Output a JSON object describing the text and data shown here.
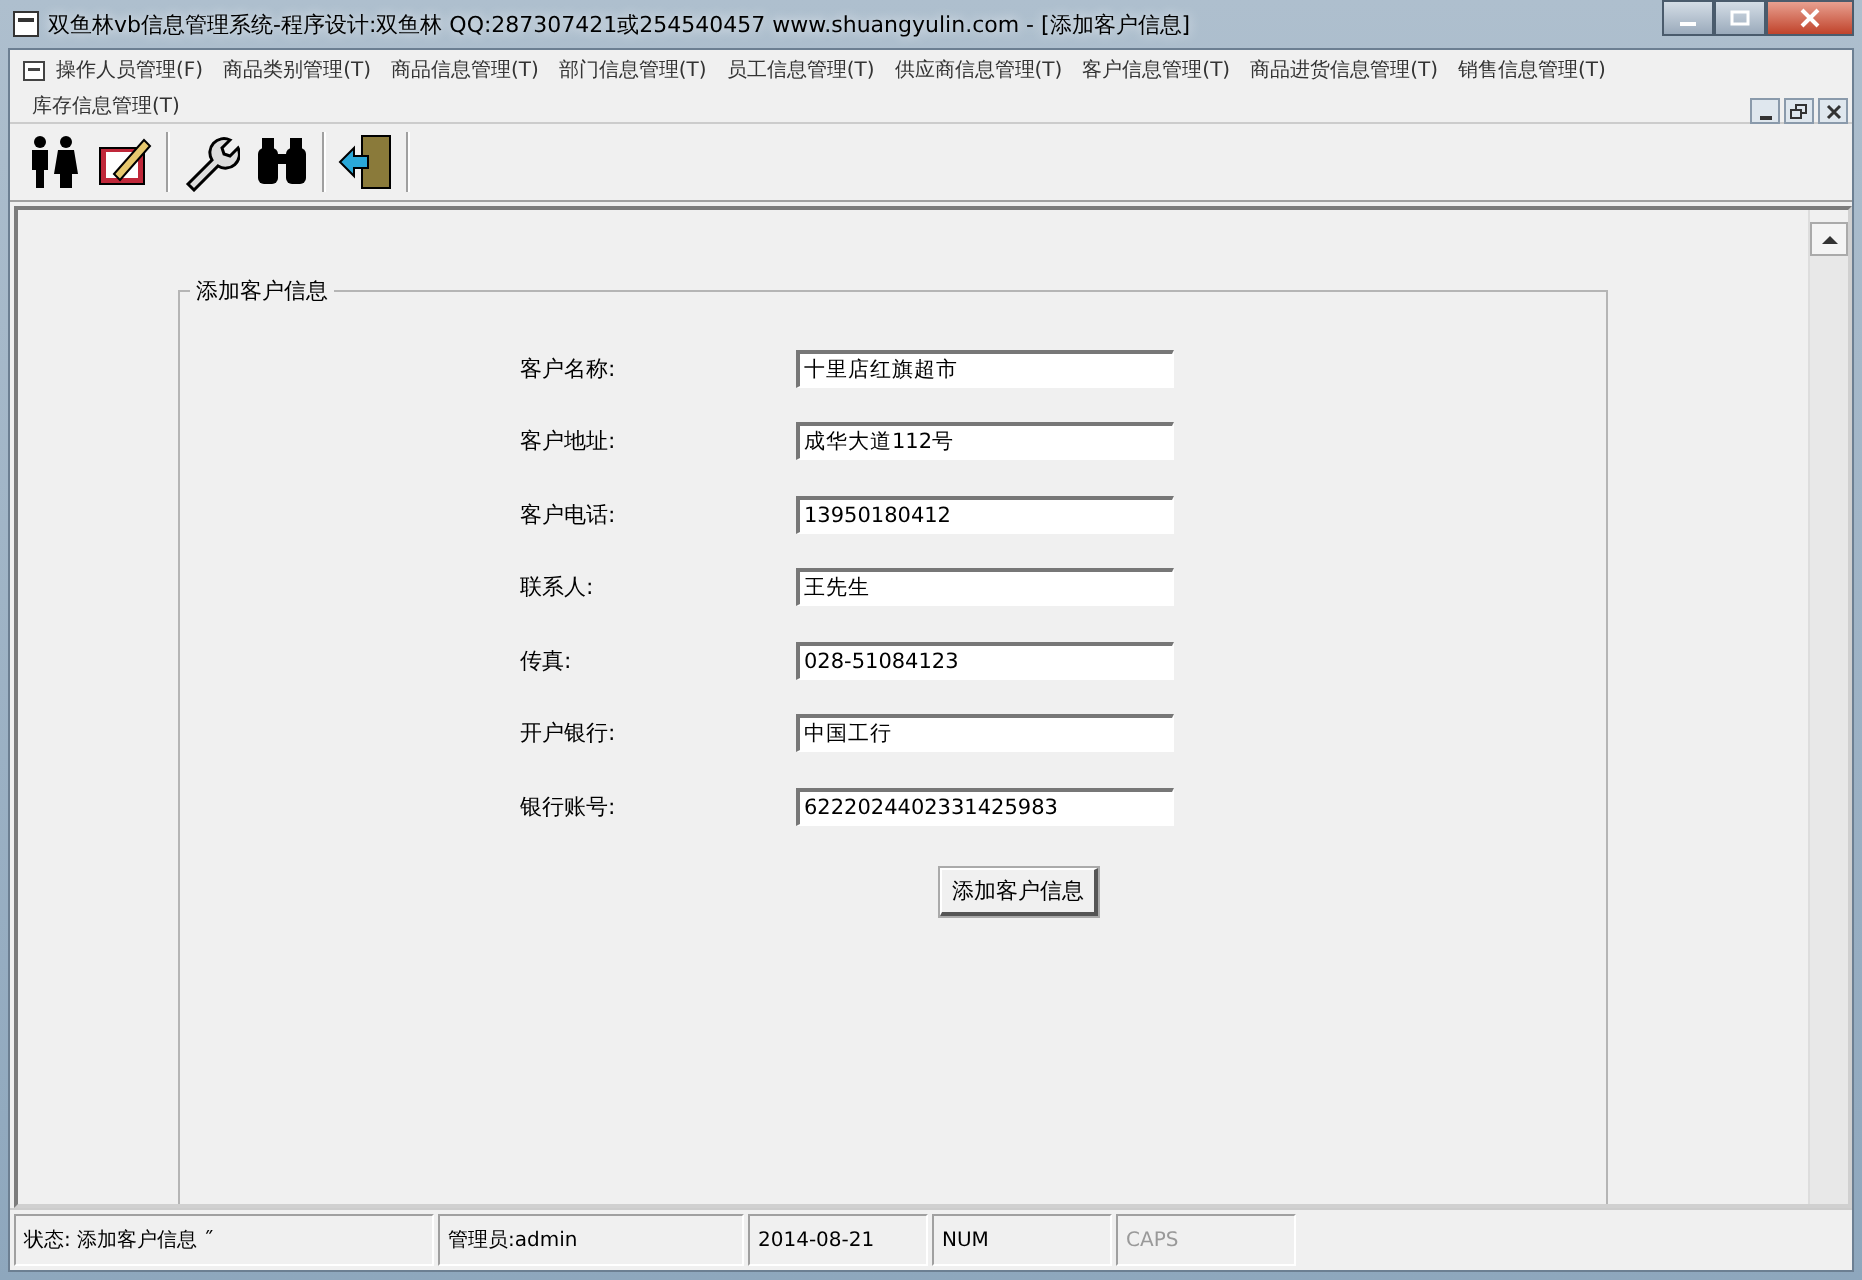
{
  "window": {
    "title": "双鱼林vb信息管理系统-程序设计:双鱼林 QQ:287307421或254540457 www.shuangyulin.com - [添加客户信息]"
  },
  "menu": [
    "操作人员管理(F)",
    "商品类别管理(T)",
    "商品信息管理(T)",
    "部门信息管理(T)",
    "员工信息管理(T)",
    "供应商信息管理(T)",
    "客户信息管理(T)",
    "商品进货信息管理(T)",
    "销售信息管理(T)",
    "库存信息管理(T)"
  ],
  "toolbar": [
    {
      "kind": "people"
    },
    {
      "kind": "edit"
    },
    {
      "kind": "wrench"
    },
    {
      "kind": "binoculars"
    },
    {
      "kind": "exit"
    }
  ],
  "form": {
    "group_title": "添加客户信息",
    "fields": [
      {
        "label": "客户名称:",
        "value": "十里店红旗超市"
      },
      {
        "label": "客户地址:",
        "value": "成华大道112号"
      },
      {
        "label": "客户电话:",
        "value": "13950180412"
      },
      {
        "label": "联系人:",
        "value": "王先生"
      },
      {
        "label": "传真:",
        "value": "028-51084123"
      },
      {
        "label": "开户银行:",
        "value": "中国工行"
      },
      {
        "label": "银行账号:",
        "value": "6222024402331425983"
      }
    ],
    "submit": "添加客户信息"
  },
  "status_bar": [
    {
      "text": "状态:  添加客户信息 ˝",
      "enabled": true
    },
    {
      "text": "管理员:admin",
      "enabled": true
    },
    {
      "text": "2014-08-21",
      "enabled": true
    },
    {
      "text": "NUM",
      "enabled": true
    },
    {
      "text": "CAPS",
      "enabled": false
    }
  ]
}
